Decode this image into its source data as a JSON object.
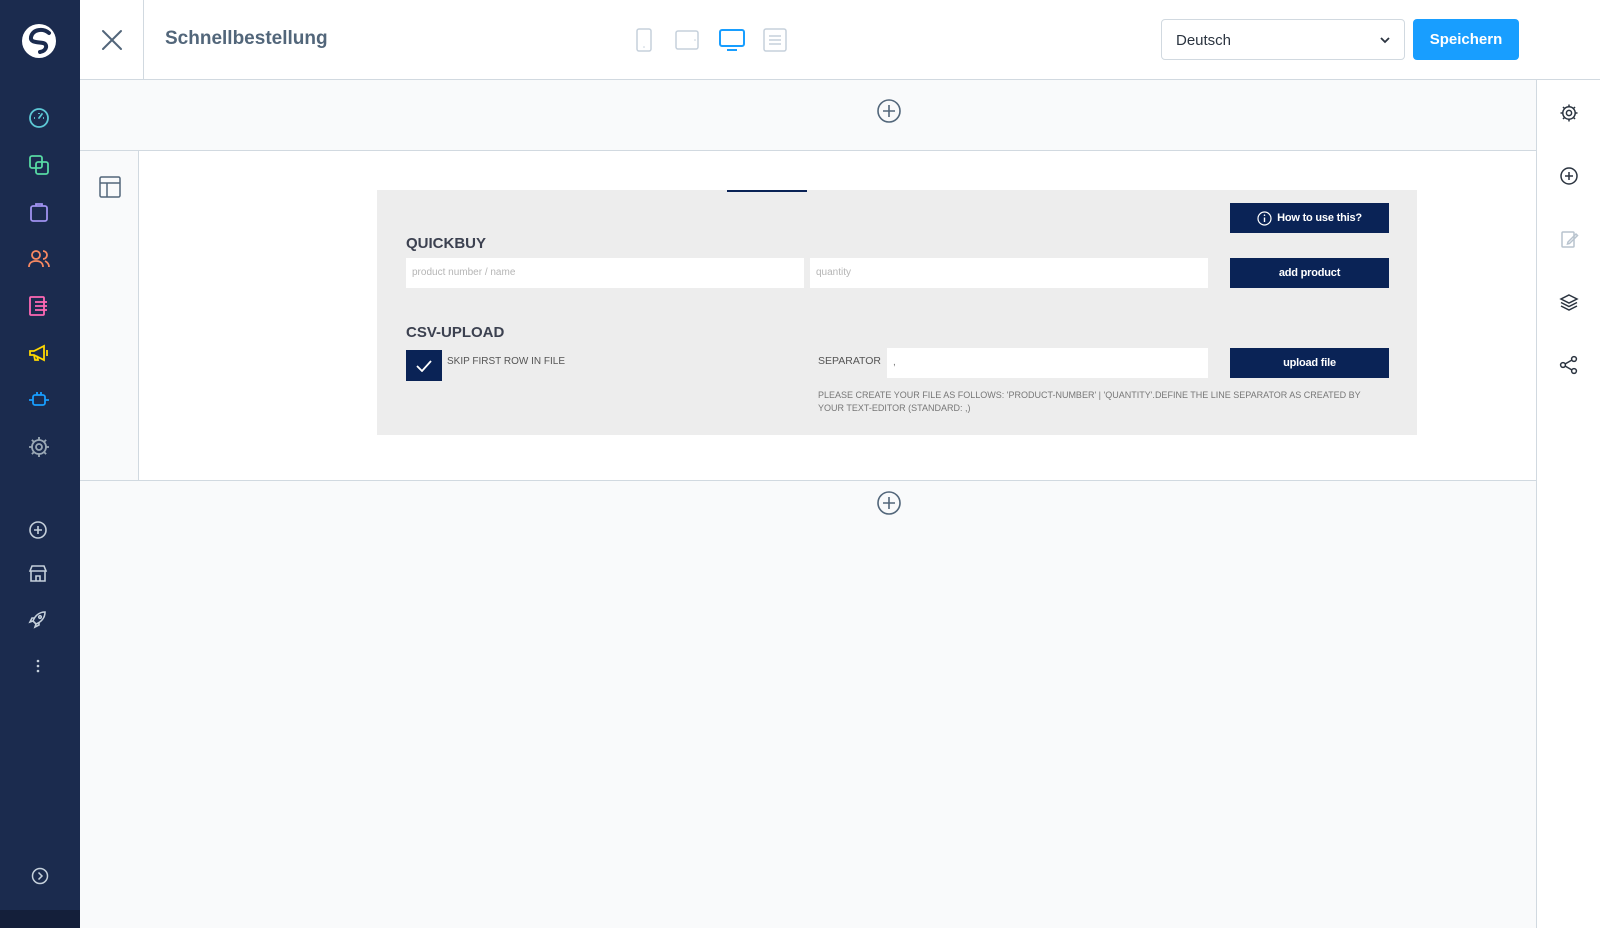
{
  "header": {
    "title": "Schnellbestellung",
    "language": "Deutsch",
    "save_label": "Speichern",
    "devices": [
      "mobile",
      "tablet",
      "desktop",
      "form"
    ],
    "active_device": "desktop"
  },
  "admin_nav": {
    "items": [
      {
        "icon": "dashboard-icon",
        "color": "#5dc9d6"
      },
      {
        "icon": "catalogue-icon",
        "color": "#57d9a3"
      },
      {
        "icon": "orders-icon",
        "color": "#a092f0"
      },
      {
        "icon": "customers-icon",
        "color": "#f88962"
      },
      {
        "icon": "content-icon",
        "color": "#ff68b4"
      },
      {
        "icon": "marketing-icon",
        "color": "#ffd700"
      },
      {
        "icon": "extensions-icon",
        "color": "#189eff"
      },
      {
        "icon": "settings-icon",
        "color": "#9aa8b5"
      }
    ],
    "secondary": [
      "add-channel-icon",
      "storefront-icon",
      "rocket-icon",
      "more-icon"
    ],
    "collapse_icon": "collapse-icon"
  },
  "right_sidebar": {
    "items": [
      "settings-icon",
      "add-block-icon",
      "edit-icon",
      "layers-icon",
      "share-icon"
    ]
  },
  "quickbuy": {
    "howto_label": "How to use this?",
    "quickbuy_heading": "QUICKBUY",
    "product_placeholder": "product number / name",
    "quantity_placeholder": "quantity",
    "add_product_label": "add product",
    "csv_heading": "CSV-UPLOAD",
    "skip_first_row_label": "SKIP FIRST ROW IN FILE",
    "skip_first_row_checked": true,
    "separator_label": "SEPARATOR",
    "separator_value": ",",
    "upload_label": "upload file",
    "note": "PLEASE CREATE YOUR FILE AS FOLLOWS: 'PRODUCT-NUMBER' | 'QUANTITY'.DEFINE THE LINE SEPARATOR AS CREATED BY YOUR TEXT-EDITOR (STANDARD: ,)"
  },
  "colors": {
    "sidebar_bg": "#1b2b4e",
    "accent": "#189eff",
    "plugin_primary": "#0a2356"
  }
}
